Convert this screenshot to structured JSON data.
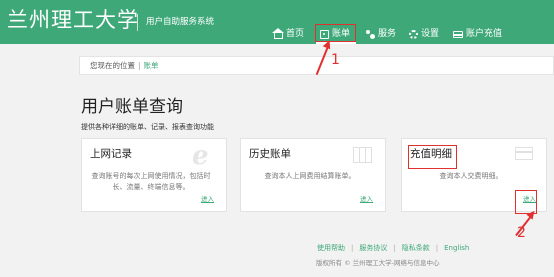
{
  "header": {
    "logo_text": "兰州理工大学",
    "system_name": "用户自助服务系统",
    "background_color": "#3ea879"
  },
  "nav": {
    "items": [
      {
        "label": "首页",
        "icon": "home-icon"
      },
      {
        "label": "账单",
        "icon": "bill-icon",
        "active": true
      },
      {
        "label": "服务",
        "icon": "service-icon"
      },
      {
        "label": "设置",
        "icon": "settings-icon"
      },
      {
        "label": "账户充值",
        "icon": "recharge-card-icon"
      }
    ]
  },
  "breadcrumb": {
    "prefix": "您现在的位置",
    "separator": "|",
    "current": "账单"
  },
  "page": {
    "title": "用户账单查询",
    "subtitle": "提供各种详细的账单、记录、报表查询功能"
  },
  "cards": [
    {
      "title": "上网记录",
      "description": "查询账号的每次上网使用情况，包括时长、流量、终端信息等。",
      "link": "进入",
      "icon": "internet-explorer-icon"
    },
    {
      "title": "历史账单",
      "description": "查询本人上网费用结算账单。",
      "link": "进入",
      "icon": "folded-map-icon"
    },
    {
      "title": "充值明细",
      "description": "查询本人交费明细。",
      "link": "进入",
      "icon": "credit-card-icon"
    }
  ],
  "footer": {
    "links": [
      "使用帮助",
      "服务协议",
      "隐私条款",
      "English"
    ],
    "copyright": "版权所有 © 兰州理工大学-网络与信息中心"
  },
  "annotations": {
    "step_1": "1",
    "step_2": "2",
    "highlight_color": "#e03030"
  }
}
